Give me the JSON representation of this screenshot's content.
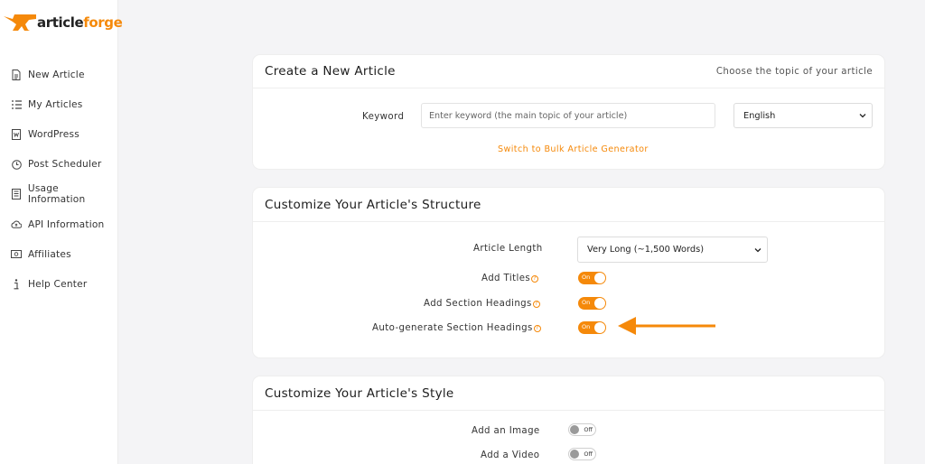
{
  "brand": {
    "name_part1": "article",
    "name_part2": "forge",
    "accent": "#f5890a"
  },
  "sidebar": {
    "items": [
      {
        "label": "New Article",
        "icon": "document-icon"
      },
      {
        "label": "My Articles",
        "icon": "list-icon"
      },
      {
        "label": "WordPress",
        "icon": "wordpress-icon"
      },
      {
        "label": "Post Scheduler",
        "icon": "clock-icon"
      },
      {
        "label": "Usage Information",
        "icon": "receipt-icon"
      },
      {
        "label": "API Information",
        "icon": "cloud-icon"
      },
      {
        "label": "Affiliates",
        "icon": "money-icon"
      },
      {
        "label": "Help Center",
        "icon": "info-icon"
      }
    ]
  },
  "create": {
    "title": "Create a New Article",
    "subtitle": "Choose the topic of your article",
    "keyword_label": "Keyword",
    "keyword_placeholder": "Enter keyword (the main topic of your article)",
    "language": "English",
    "bulk_link": "Switch to Bulk Article Generator"
  },
  "structure": {
    "title": "Customize Your Article's Structure",
    "length_label": "Article Length",
    "length_value": "Very Long (~1,500 Words)",
    "add_titles_label": "Add Titles",
    "add_section_headings_label": "Add Section Headings",
    "auto_headings_label": "Auto-generate Section Headings",
    "add_titles_state": "On",
    "add_section_headings_state": "On",
    "auto_headings_state": "On"
  },
  "style": {
    "title": "Customize Your Article's Style",
    "add_image_label": "Add an Image",
    "add_video_label": "Add a Video",
    "add_image_state": "Off",
    "add_video_state": "Off"
  }
}
